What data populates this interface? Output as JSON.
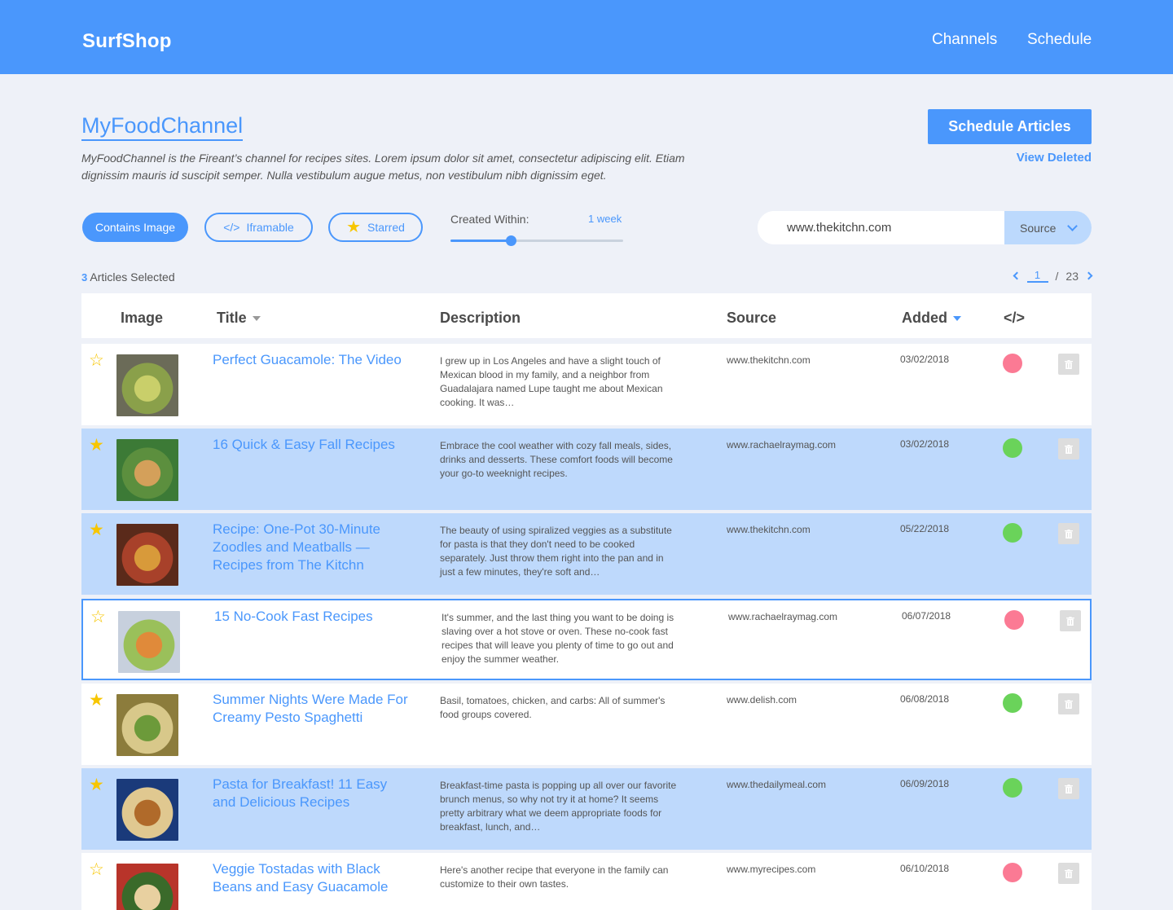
{
  "header": {
    "brand": "SurfShop",
    "nav": [
      "Channels",
      "Schedule"
    ]
  },
  "channel": {
    "title": "MyFoodChannel",
    "description": "MyFoodChannel is the Fireant’s channel for recipes sites. Lorem ipsum dolor sit amet, consectetur adipiscing elit. Etiam dignissim mauris id suscipit semper. Nulla vestibulum augue metus, non vestibulum nibh dignissim eget.",
    "schedule_button": "Schedule Articles",
    "view_deleted": "View Deleted"
  },
  "filters": {
    "contains_image": "Contains Image",
    "iframable": "Iframable",
    "iframable_icon": "</>",
    "starred": "Starred",
    "created_within_label": "Created Within:",
    "created_within_value": "1 week",
    "created_within_level": 0.35,
    "source_value": "www.thekitchn.com",
    "source_dropdown": "Source"
  },
  "selection": {
    "count": "3",
    "label": " Articles Selected"
  },
  "pager": {
    "current": "1",
    "separator": "/",
    "total": "23"
  },
  "table": {
    "headers": {
      "image": "Image",
      "title": "Title",
      "description": "Description",
      "source": "Source",
      "added": "Added",
      "iframe": "</>"
    },
    "rows": [
      {
        "starred": false,
        "selected": false,
        "title": "Perfect Guacamole: The Video",
        "description": "I grew up in Los Angeles and have a slight touch of Mexican blood in my family, and a neighbor from Guadalajara named Lupe taught me about Mexican cooking. It was…",
        "source": "www.thekitchn.com",
        "added": "03/02/2018",
        "iframable": false
      },
      {
        "starred": true,
        "selected": true,
        "title": "16 Quick & Easy Fall Recipes",
        "description": "Embrace the cool weather with cozy fall meals, sides, drinks and desserts. These comfort foods will become your go-to weeknight recipes.",
        "source": "www.rachaelraymag.com",
        "added": "03/02/2018",
        "iframable": true
      },
      {
        "starred": true,
        "selected": true,
        "title": "Recipe: One-Pot 30-Minute Zoodles and Meatballs — Recipes from The Kitchn",
        "description": "The beauty of using spiralized veggies as a substitute for pasta is that they don't need to be cooked separately. Just throw them right into the pan and in just a few minutes, they're soft and…",
        "source": "www.thekitchn.com",
        "added": "05/22/2018",
        "iframable": true
      },
      {
        "starred": false,
        "selected": false,
        "title": "15 No-Cook Fast Recipes",
        "description": "It's summer, and the last thing you want to be doing is slaving over a hot stove or oven. These no-cook fast recipes that will leave you plenty of time to go out and enjoy the summer weather.",
        "source": "www.rachaelraymag.com",
        "added": "06/07/2018",
        "iframable": false
      },
      {
        "starred": true,
        "selected": false,
        "title": "Summer Nights Were Made For Creamy Pesto Spaghetti",
        "description": "Basil, tomatoes, chicken, and carbs: All of summer's food groups covered.",
        "source": "www.delish.com",
        "added": "06/08/2018",
        "iframable": true
      },
      {
        "starred": true,
        "selected": true,
        "title": "Pasta for Breakfast! 11 Easy and Delicious Recipes",
        "description": "Breakfast-time pasta is popping up all over our favorite brunch menus, so why not try it at home? It seems pretty arbitrary what we deem appropriate foods for breakfast, lunch, and…",
        "source": "www.thedailymeal.com",
        "added": "06/09/2018",
        "iframable": true
      },
      {
        "starred": false,
        "selected": false,
        "title": "Veggie Tostadas with Black Beans and Easy Guacamole",
        "description": "Here's another recipe that everyone in the family can customize to their own tastes.",
        "source": "www.myrecipes.com",
        "added": "06/10/2018",
        "iframable": false
      }
    ]
  },
  "colors": {
    "accent": "#4a97fc",
    "selected_row": "#bed9fc",
    "star": "#f7c600",
    "iframe_yes": "#6ad35a",
    "iframe_no": "#fb7a94"
  }
}
